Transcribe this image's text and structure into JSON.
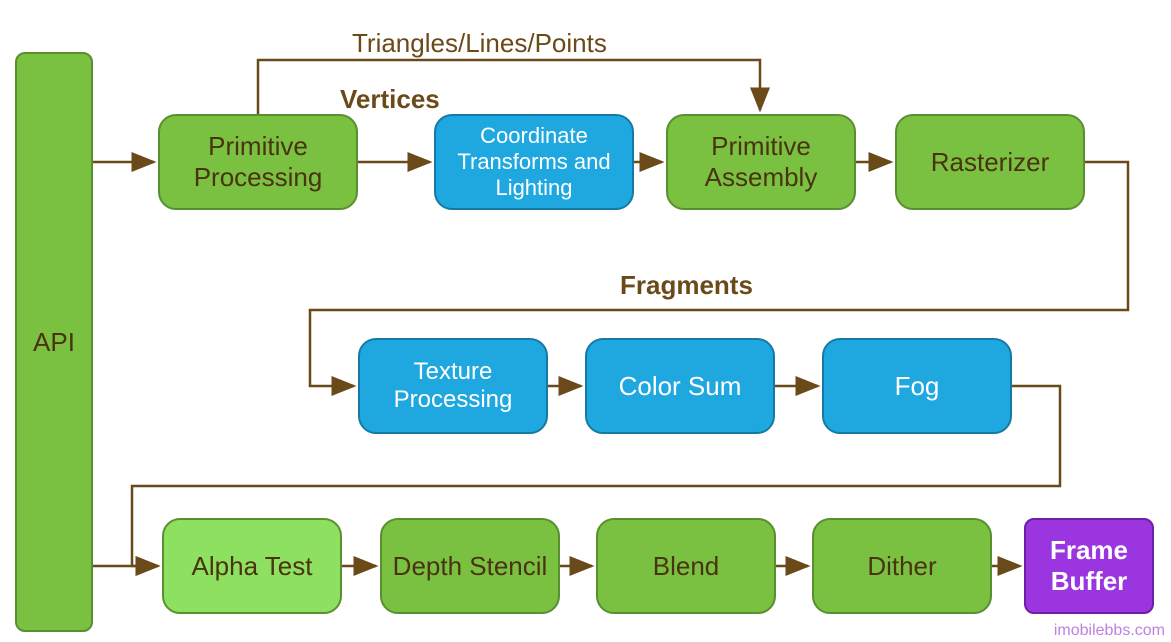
{
  "labels": {
    "triangles": "Triangles/Lines/Points",
    "vertices": "Vertices",
    "fragments": "Fragments",
    "watermark": "imobilebbs.com"
  },
  "boxes": {
    "api": "API",
    "primitive_processing": "Primitive Processing",
    "coordinate_transforms": "Coordinate Transforms and Lighting",
    "primitive_assembly": "Primitive Assembly",
    "rasterizer": "Rasterizer",
    "texture_processing": "Texture Processing",
    "color_sum": "Color Sum",
    "fog": "Fog",
    "alpha_test": "Alpha Test",
    "depth_stencil": "Depth Stencil",
    "blend": "Blend",
    "dither": "Dither",
    "frame_buffer": "Frame Buffer"
  }
}
